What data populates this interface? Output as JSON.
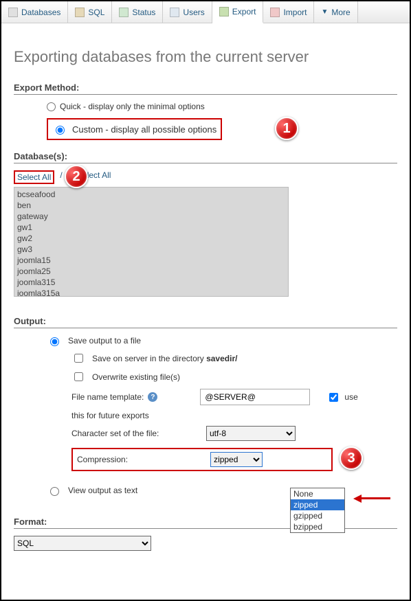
{
  "tabs": {
    "databases": "Databases",
    "sql": "SQL",
    "status": "Status",
    "users": "Users",
    "export": "Export",
    "import": "Import",
    "more": "More"
  },
  "page_title": "Exporting databases from the current server",
  "sections": {
    "export_method": "Export Method:",
    "databases": "Database(s):",
    "output": "Output:",
    "format": "Format:"
  },
  "method": {
    "quick": "Quick - display only the minimal options",
    "custom": "Custom - display all possible options"
  },
  "db": {
    "select_all": "Select All",
    "unselect_all": "Unselect All",
    "items": [
      "bcseafood",
      "ben",
      "gateway",
      "gw1",
      "gw2",
      "gw3",
      "joomla15",
      "joomla25",
      "joomla315",
      "joomla315a"
    ]
  },
  "output": {
    "save_to_file": "Save output to a file",
    "save_on_server_pre": "Save on server in the directory ",
    "save_on_server_dir": "savedir/",
    "overwrite": "Overwrite existing file(s)",
    "filename_tpl": "File name template:",
    "filename_value": "@SERVER@",
    "use": "use",
    "future": "this for future exports",
    "charset": "Character set of the file:",
    "charset_value": "utf-8",
    "compression": "Compression:",
    "compression_value": "zipped",
    "compression_options": [
      "None",
      "zipped",
      "gzipped",
      "bzipped"
    ],
    "view_as_text": "View output as text"
  },
  "format": {
    "value": "SQL"
  },
  "badges": {
    "one": "1",
    "two": "2",
    "three": "3"
  }
}
